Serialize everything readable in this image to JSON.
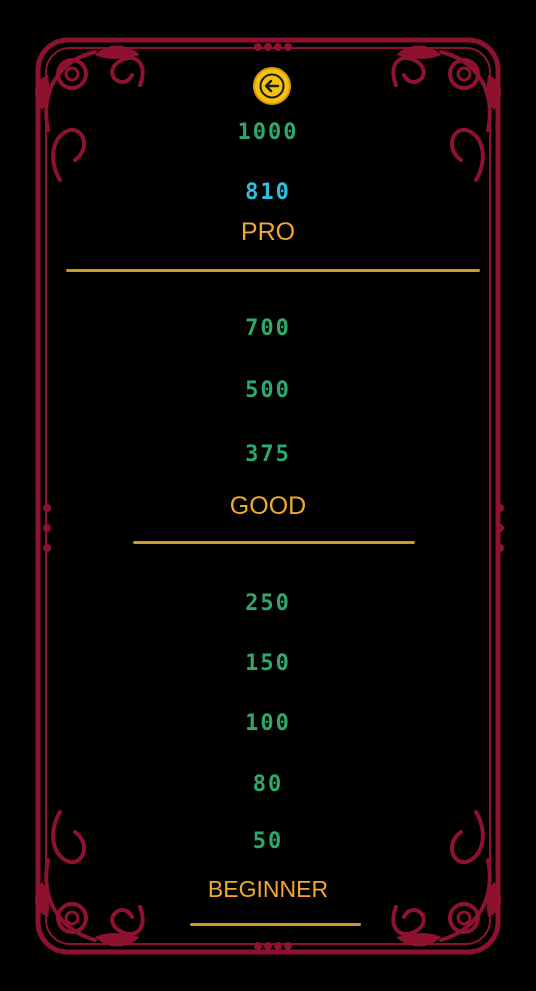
{
  "colors": {
    "frame": "#8e1230",
    "frame_accent": "#6a0a22",
    "score": "#2fa86c",
    "current_score": "#2bc2dc",
    "rank": "#f0a92d",
    "divider": "#c99a2a",
    "back_button": "#f4c20d"
  },
  "header": {
    "back_icon": "arrow-left-icon"
  },
  "tiers": [
    {
      "name": "PRO",
      "scores": [
        "1000"
      ],
      "current_score": "810"
    },
    {
      "name": "GOOD",
      "scores": [
        "700",
        "500",
        "375"
      ]
    },
    {
      "name": "BEGINNER",
      "scores": [
        "250",
        "150",
        "100",
        "80",
        "50"
      ]
    }
  ]
}
